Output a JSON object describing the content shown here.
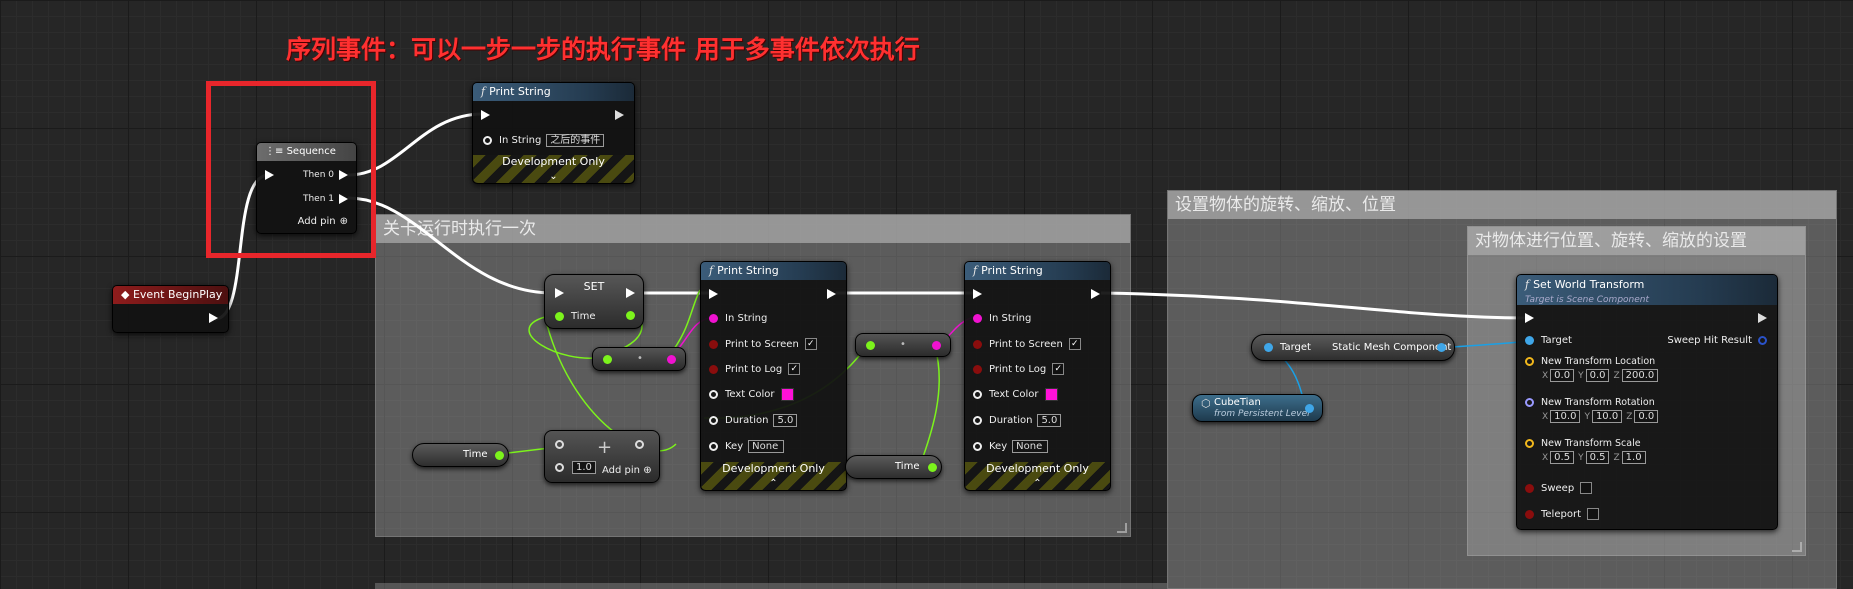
{
  "annotation": {
    "heading": "序列事件：可以一步一步的执行事件 用于多事件依次执行"
  },
  "comments": {
    "level_once": "关卡运行时执行一次",
    "set_transform_outer": "设置物体的旋转、缩放、位置",
    "set_transform_inner": "对物体进行位置、旋转、缩放的设置"
  },
  "event_begin_play": {
    "title": "Event BeginPlay"
  },
  "sequence": {
    "title": "Sequence",
    "then0": "Then 0",
    "then1": "Then 1",
    "add_pin": "Add pin"
  },
  "print_top": {
    "title": "Print String",
    "in_string_label": "In String",
    "in_string_value": "之后的事件",
    "dev_only": "Development Only"
  },
  "set_node": {
    "title": "SET",
    "var_label": "Time"
  },
  "time_getter_1": {
    "label": "Time"
  },
  "time_getter_2": {
    "label": "Time"
  },
  "add_node": {
    "value": "1.0",
    "add_pin": "Add pin"
  },
  "print_mid": {
    "title": "Print String",
    "in_string": "In String",
    "print_to_screen": "Print to Screen",
    "print_to_log": "Print to Log",
    "text_color": "Text Color",
    "duration": "Duration",
    "duration_value": "5.0",
    "key": "Key",
    "key_value": "None",
    "dev_only": "Development Only"
  },
  "print_right": {
    "title": "Print String",
    "in_string": "In String",
    "print_to_screen": "Print to Screen",
    "print_to_log": "Print to Log",
    "text_color": "Text Color",
    "duration": "Duration",
    "duration_value": "5.0",
    "key": "Key",
    "key_value": "None",
    "dev_only": "Development Only"
  },
  "target_node": {
    "target": "Target",
    "component": "Static Mesh Component"
  },
  "cube_node": {
    "name": "CubeTian",
    "sub": "from Persistent Level"
  },
  "set_world_transform": {
    "title": "Set World Transform",
    "subtitle": "Target is Scene Component",
    "target": "Target",
    "sweep_hit": "Sweep Hit Result",
    "location_label": "New Transform Location",
    "loc_x": "0.0",
    "loc_y": "0.0",
    "loc_z": "200.0",
    "rotation_label": "New Transform Rotation",
    "rot_x": "10.0",
    "rot_y": "10.0",
    "rot_z": "0.0",
    "scale_label": "New Transform Scale",
    "scale_x": "0.5",
    "scale_y": "0.5",
    "scale_z": "1.0",
    "sweep": "Sweep",
    "teleport": "Teleport",
    "x": "X",
    "y": "Y",
    "z": "Z"
  },
  "colors": {
    "exec": "#ffffff",
    "string_pin": "#f012d0",
    "float_pin": "#7cf31c",
    "object_pin": "#1aa0e6",
    "highlight": "#e8262b"
  }
}
